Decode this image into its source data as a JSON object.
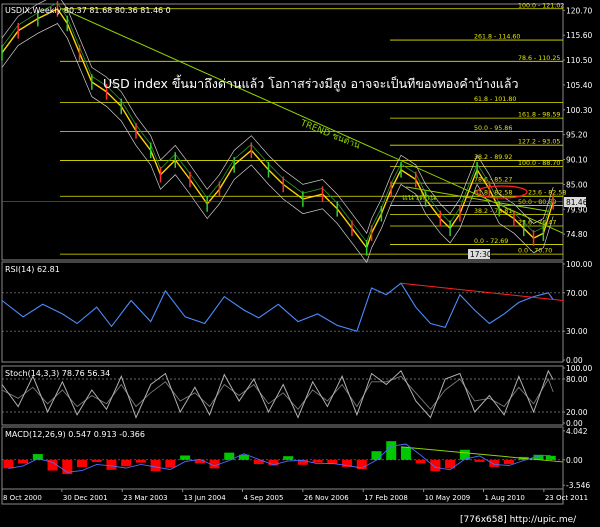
{
  "main_header": "USDIX,Weekly  80.37 81.68 80.36 81.46  0",
  "headline": "USD index ขึ้นมาถึงด่านแล้ว โอกาสร่วงมีสูง อาจจะเป็นทีของทองคำบ้างแล้ว",
  "trend_label": "TREND ชนต้าน",
  "resist_label": "แนวต้าน",
  "last_price": "81.46",
  "time_box": "17:30",
  "watermark": "[776x658] http://upic.me/",
  "colors": {
    "bg": "#000000",
    "price": "#ffd200",
    "rsi": "#4c8cff",
    "stoch": "#b0b0b0",
    "macd_up": "#00c800",
    "macd_dn": "#ff0000",
    "trend": "#8fd400",
    "fib": "#e6e600",
    "highlight": "#ff2020"
  },
  "chart_data": [
    {
      "type": "line",
      "name": "price",
      "title": "",
      "ylim": [
        69.5,
        122
      ],
      "yticks": [
        "120.70",
        "115.60",
        "110.50",
        "105.40",
        "100.30",
        "95.20",
        "90.10",
        "85.00",
        "79.90",
        "74.80"
      ],
      "ytick_values": [
        120.7,
        115.6,
        110.5,
        105.4,
        100.3,
        95.2,
        90.1,
        85.0,
        79.9,
        74.8
      ],
      "fib_levels": [
        {
          "label": "100.0 - 121.02",
          "value": 121.02
        },
        {
          "label": "261.8 - 114.60",
          "value": 114.6
        },
        {
          "label": "78.6 - 110.25",
          "value": 110.25
        },
        {
          "label": "61.8 - 101.80",
          "value": 101.8
        },
        {
          "label": "161.8 - 98.59",
          "value": 98.59
        },
        {
          "label": "50.0 - 95.86",
          "value": 95.86
        },
        {
          "label": "127.2 - 93.05",
          "value": 93.05
        },
        {
          "label": "38.2 - 89.92",
          "value": 89.92
        },
        {
          "label": "100.0 - 88.70",
          "value": 88.7
        },
        {
          "label": "78.6 - 85.27",
          "value": 85.27
        },
        {
          "label": "23.6 - 82.58",
          "value": 82.58
        },
        {
          "label": "61.8 - 82.58",
          "value": 82.58
        },
        {
          "label": "50.0 - 80.69",
          "value": 80.69
        },
        {
          "label": "38.2 - 78.81",
          "value": 78.81
        },
        {
          "label": "23.6 - 76.47",
          "value": 76.47
        },
        {
          "label": "0.0 - 72.69",
          "value": 72.69
        },
        {
          "label": "0.0 - 70.70",
          "value": 70.7
        }
      ],
      "x_dates": [
        "8 Oct 2000",
        "30 Dec 2001",
        "23 Mar 2003",
        "13 Jun 2004",
        "4 Sep 2005",
        "26 Nov 2006",
        "17 Feb 2008",
        "10 May 2009",
        "1 Aug 2010",
        "23 Oct 2011"
      ],
      "x_years": [
        2000.77,
        2001.99,
        2003.22,
        2004.45,
        2005.67,
        2006.9,
        2008.13,
        2009.36,
        2010.58,
        2011.81
      ],
      "series": [
        {
          "x": [
            2000.77,
            2001.1,
            2001.5,
            2001.9,
            2002.1,
            2002.35,
            2002.6,
            2002.9,
            2003.2,
            2003.5,
            2003.8,
            2004.0,
            2004.3,
            2004.6,
            2004.95,
            2005.2,
            2005.5,
            2005.85,
            2006.2,
            2006.5,
            2006.9,
            2007.3,
            2007.6,
            2007.9,
            2008.2,
            2008.3,
            2008.5,
            2008.7,
            2008.9,
            2009.2,
            2009.4,
            2009.7,
            2009.9,
            2010.1,
            2010.45,
            2010.7,
            2010.9,
            2011.2,
            2011.4,
            2011.6,
            2011.8,
            2012.0
          ],
          "values": [
            112,
            116.5,
            119,
            121,
            118,
            112,
            106,
            104,
            101,
            96,
            92,
            87,
            90,
            86,
            81,
            84,
            89,
            92,
            88,
            85,
            82,
            83,
            80,
            76,
            72,
            75,
            79,
            84,
            88,
            86,
            82,
            78,
            76,
            79,
            88,
            84,
            80,
            78,
            76,
            74,
            75,
            81.46
          ]
        }
      ],
      "trendline": {
        "from": [
          2002.0,
          121.0
        ],
        "to": [
          2012.2,
          75.0
        ]
      },
      "resistance_trend": {
        "from": [
          2009.0,
          84.5
        ],
        "to": [
          2011.9,
          79.5
        ]
      }
    },
    {
      "type": "line",
      "name": "RSI",
      "title": "RSI(14) 62.81",
      "ylim": [
        0,
        100
      ],
      "yticks": [
        "100.00",
        "70.00",
        "30.00",
        "0.00"
      ],
      "ytick_values": [
        100,
        70,
        30,
        0
      ],
      "levels": [
        70,
        30
      ],
      "series": [
        {
          "x": [
            2000.77,
            2001.2,
            2001.6,
            2002.0,
            2002.3,
            2002.7,
            2003.0,
            2003.4,
            2003.8,
            2004.1,
            2004.5,
            2004.9,
            2005.3,
            2005.7,
            2006.0,
            2006.4,
            2006.8,
            2007.2,
            2007.6,
            2008.0,
            2008.3,
            2008.6,
            2008.9,
            2009.2,
            2009.5,
            2009.8,
            2010.1,
            2010.4,
            2010.7,
            2011.0,
            2011.3,
            2011.6,
            2011.9,
            2012.0
          ],
          "values": [
            62,
            45,
            58,
            48,
            38,
            55,
            35,
            62,
            40,
            72,
            45,
            38,
            66,
            52,
            44,
            58,
            40,
            48,
            36,
            30,
            75,
            68,
            80,
            55,
            38,
            34,
            68,
            52,
            38,
            48,
            60,
            66,
            70,
            62.81
          ]
        }
      ],
      "trendline": {
        "from": [
          2008.9,
          80
        ],
        "to": [
          2012.2,
          62
        ]
      }
    },
    {
      "type": "line",
      "name": "Stochastic",
      "title": "Stoch(14,3,3) 78.76 56.34",
      "ylim": [
        0,
        100
      ],
      "yticks": [
        "100.00",
        "80.00",
        "20.00",
        "0.00"
      ],
      "ytick_values": [
        100,
        80,
        20,
        0
      ],
      "levels": [
        80,
        20
      ],
      "series": [
        {
          "name": "%K",
          "x": [
            2000.77,
            2001.1,
            2001.4,
            2001.7,
            2002.0,
            2002.3,
            2002.6,
            2002.9,
            2003.2,
            2003.5,
            2003.8,
            2004.1,
            2004.4,
            2004.7,
            2005.0,
            2005.3,
            2005.6,
            2005.9,
            2006.2,
            2006.5,
            2006.8,
            2007.1,
            2007.4,
            2007.7,
            2008.0,
            2008.3,
            2008.6,
            2008.9,
            2009.2,
            2009.5,
            2009.8,
            2010.1,
            2010.4,
            2010.7,
            2011.0,
            2011.3,
            2011.6,
            2011.9,
            2012.0
          ],
          "values": [
            70,
            30,
            85,
            20,
            75,
            15,
            60,
            25,
            85,
            10,
            70,
            90,
            20,
            65,
            15,
            88,
            40,
            80,
            20,
            70,
            10,
            75,
            30,
            85,
            15,
            90,
            70,
            95,
            40,
            10,
            80,
            90,
            20,
            50,
            15,
            85,
            20,
            95,
            78.76
          ]
        },
        {
          "name": "%D",
          "x": [
            2000.77,
            2001.1,
            2001.4,
            2001.7,
            2002.0,
            2002.3,
            2002.6,
            2002.9,
            2003.2,
            2003.5,
            2003.8,
            2004.1,
            2004.4,
            2004.7,
            2005.0,
            2005.3,
            2005.6,
            2005.9,
            2006.2,
            2006.5,
            2006.8,
            2007.1,
            2007.4,
            2007.7,
            2008.0,
            2008.3,
            2008.6,
            2008.9,
            2009.2,
            2009.5,
            2009.8,
            2010.1,
            2010.4,
            2010.7,
            2011.0,
            2011.3,
            2011.6,
            2011.9,
            2012.0
          ],
          "values": [
            60,
            45,
            65,
            35,
            60,
            30,
            50,
            35,
            70,
            30,
            55,
            75,
            40,
            55,
            30,
            70,
            50,
            70,
            35,
            55,
            25,
            60,
            40,
            70,
            30,
            75,
            75,
            85,
            55,
            25,
            60,
            80,
            40,
            45,
            30,
            65,
            35,
            80,
            56.34
          ]
        }
      ]
    },
    {
      "type": "bar",
      "name": "MACD",
      "title": "MACD(12,26,9) 0.547 0.913 -0.366",
      "ylim": [
        -3.8,
        4.3
      ],
      "yticks": [
        "4.042",
        "0.00",
        "-3.546"
      ],
      "ytick_values": [
        4.042,
        0.0,
        -3.546
      ],
      "histogram": {
        "x": [
          2000.9,
          2001.2,
          2001.5,
          2001.8,
          2002.1,
          2002.4,
          2002.7,
          2003.0,
          2003.3,
          2003.6,
          2003.9,
          2004.2,
          2004.5,
          2004.8,
          2005.1,
          2005.4,
          2005.7,
          2006.0,
          2006.3,
          2006.6,
          2006.9,
          2007.2,
          2007.5,
          2007.8,
          2008.1,
          2008.4,
          2008.7,
          2009.0,
          2009.3,
          2009.6,
          2009.9,
          2010.2,
          2010.5,
          2010.8,
          2011.1,
          2011.4,
          2011.7,
          2011.95
        ],
        "values": [
          -1.2,
          -0.5,
          0.8,
          -1.5,
          -2.0,
          -1.0,
          -0.3,
          -1.4,
          -0.9,
          -0.4,
          -1.6,
          -1.1,
          0.6,
          -0.5,
          -1.2,
          1.0,
          0.7,
          -0.6,
          -0.8,
          0.5,
          -0.7,
          -0.4,
          -0.6,
          -1.0,
          -1.3,
          1.2,
          2.6,
          1.8,
          -0.5,
          -1.6,
          -1.2,
          1.4,
          -0.3,
          -1.0,
          -0.6,
          0.4,
          0.7,
          0.547
        ]
      },
      "trendline": {
        "from": [
          2008.9,
          1.8
        ],
        "to": [
          2012.2,
          -0.3
        ]
      }
    }
  ]
}
